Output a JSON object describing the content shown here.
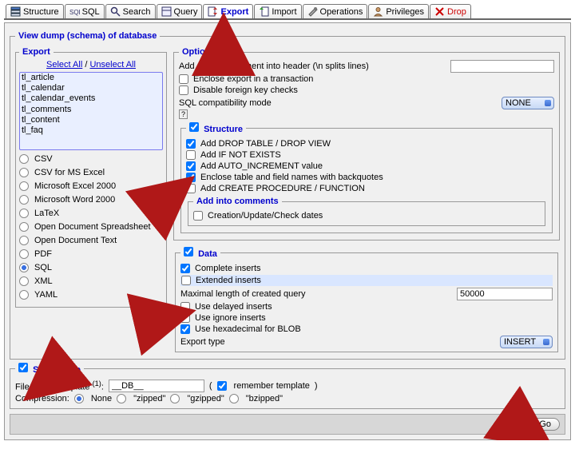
{
  "tabs": {
    "structure": "Structure",
    "sql": "SQL",
    "search": "Search",
    "query": "Query",
    "export": "Export",
    "import": "Import",
    "operations": "Operations",
    "privileges": "Privileges",
    "drop": "Drop"
  },
  "main_legend": "View dump (schema) of database",
  "export": {
    "legend": "Export",
    "select_all": "Select All",
    "unselect_all": "Unselect All",
    "tables": [
      "tl_article",
      "tl_calendar",
      "tl_calendar_events",
      "tl_comments",
      "tl_content",
      "tl_faq"
    ],
    "formats": {
      "csv": "CSV",
      "csv_excel": "CSV for MS Excel",
      "excel2000": "Microsoft Excel 2000",
      "word2000": "Microsoft Word 2000",
      "latex": "LaTeX",
      "ods": "Open Document Spreadsheet",
      "odt": "Open Document Text",
      "pdf": "PDF",
      "sql": "SQL",
      "xml": "XML",
      "yaml": "YAML"
    }
  },
  "options": {
    "legend": "Options",
    "comment_label": "Add custom comment into header (\\n splits lines)",
    "enclose_tx": "Enclose export in a transaction",
    "disable_fk": "Disable foreign key checks",
    "compat_label": "SQL compatibility mode",
    "compat_value": "NONE",
    "help_icon": "?"
  },
  "structure": {
    "legend": "Structure",
    "drop": "Add DROP TABLE / DROP VIEW",
    "ifnotexists": "Add IF NOT EXISTS",
    "autoinc": "Add AUTO_INCREMENT value",
    "backquote": "Enclose table and field names with backquotes",
    "createproc": "Add CREATE PROCEDURE / FUNCTION",
    "comments_legend": "Add into comments",
    "dates": "Creation/Update/Check dates"
  },
  "data": {
    "legend": "Data",
    "complete": "Complete inserts",
    "extended": "Extended inserts",
    "maxlen_label": "Maximal length of created query",
    "maxlen_value": "50000",
    "delayed": "Use delayed inserts",
    "ignore": "Use ignore inserts",
    "hexblob": "Use hexadecimal for BLOB",
    "export_type_label": "Export type",
    "export_type_value": "INSERT"
  },
  "saveas": {
    "legend": "Save as file",
    "template_label": "File name template",
    "template_sup": "(1)",
    "template_value": "__DB__",
    "remember": "remember template",
    "compression_label": "Compression:",
    "none": "None",
    "zipped": "\"zipped\"",
    "gzipped": "\"gzipped\"",
    "bzipped": "\"bzipped\""
  },
  "go": "Go"
}
